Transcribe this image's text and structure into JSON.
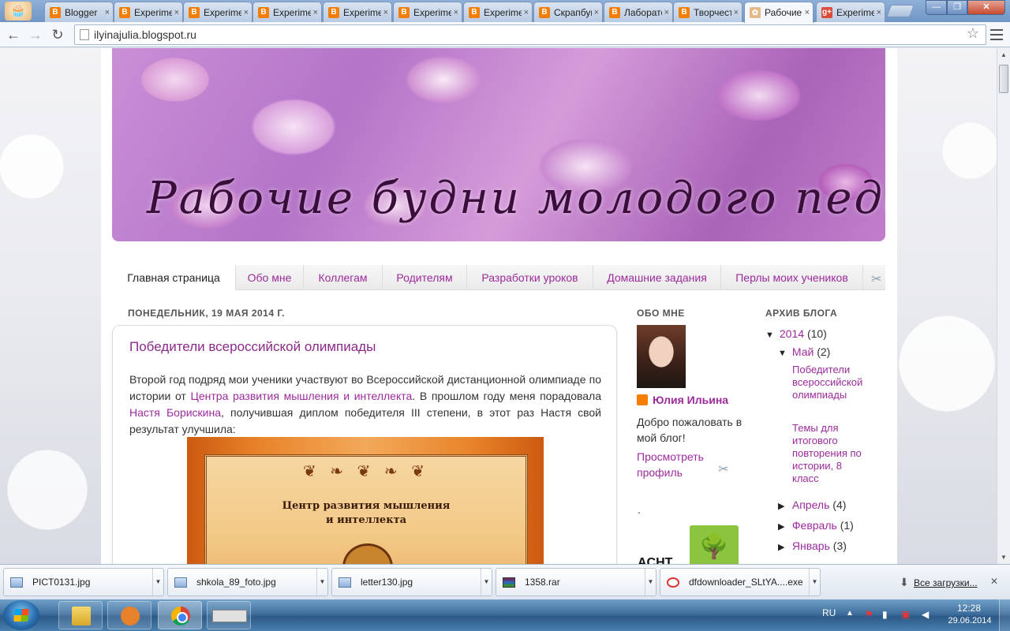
{
  "browser": {
    "tabs": [
      {
        "title": "Blogger",
        "icon": "blogger-icon"
      },
      {
        "title": "Experiment",
        "icon": "blogger-icon"
      },
      {
        "title": "Experiment",
        "icon": "blogger-icon"
      },
      {
        "title": "Experiment",
        "icon": "blogger-icon"
      },
      {
        "title": "Experiment",
        "icon": "blogger-icon"
      },
      {
        "title": "Experiment",
        "icon": "blogger-icon"
      },
      {
        "title": "Experiment",
        "icon": "blogger-icon"
      },
      {
        "title": "Скрапбукинг",
        "icon": "blogger-icon"
      },
      {
        "title": "Лаборатория",
        "icon": "blogger-icon"
      },
      {
        "title": "Творчество",
        "icon": "blogger-icon"
      },
      {
        "title": "Рабочие будни",
        "icon": "rose-icon",
        "active": true
      },
      {
        "title": "Experiment",
        "icon": "google-plus-icon"
      }
    ],
    "tab_close": "×",
    "url": "ilyinajulia.blogspot.ru",
    "bookmark_star": "☆"
  },
  "blog": {
    "title": "Рабочие будни молодого педагога",
    "nav": [
      "Главная страница",
      "Обо мне",
      "Коллегам",
      "Родителям",
      "Разработки уроков",
      "Домашние задания",
      "Перлы моих учеников"
    ],
    "date_header": "ПОНЕДЕЛЬНИК, 19 МАЯ 2014 Г.",
    "post": {
      "title": "Победители всероссийской олимпиады",
      "p1": "Второй год подряд мои ученики участвуют во Всероссийской дистанционной олимпиаде по истории от ",
      "link1": "Центра развития мышления и интеллекта",
      "p2": ". В прошлом году меня порадовала ",
      "link2": "Настя Борискина",
      "p3": ", получившая диплом победителя III степени, в этот раз Настя свой результат улучшила:",
      "certificate_text_line1": "Центр развития мышления",
      "certificate_text_line2": "и интеллекта"
    },
    "sidebar": {
      "about_header": "ОБО МНЕ",
      "profile_name": "Юлия Ильина",
      "profile_desc": "Добро пожаловать в мой блог!",
      "profile_link": "Просмотреть профиль",
      "dot": ".",
      "partial_logo_text": "ACHT",
      "archive_header": "АРХИВ БЛОГА",
      "archive": {
        "year": "2014",
        "year_count": "(10)",
        "may": "Май",
        "may_count": "(2)",
        "may_posts": [
          "Победители всероссийской олимпиады",
          "Темы для итогового повторения по истории, 8 класс"
        ],
        "april": "Апрель",
        "april_count": "(4)",
        "february": "Февраль",
        "february_count": "(1)",
        "january": "Январь",
        "january_count": "(3)"
      }
    }
  },
  "downloads": {
    "items": [
      {
        "name": "PICT0131.jpg",
        "type": "image-file-icon"
      },
      {
        "name": "shkola_89_foto.jpg",
        "type": "image-file-icon"
      },
      {
        "name": "letter130.jpg",
        "type": "image-file-icon"
      },
      {
        "name": "1358.rar",
        "type": "archive-file-icon"
      },
      {
        "name": "dfdownloader_SLtYA....exe",
        "type": "exe-file-icon"
      }
    ],
    "show_all": "Все загрузки..."
  },
  "taskbar": {
    "language": "RU",
    "time": "12:28",
    "date": "29.06.2014"
  },
  "colors": {
    "link": "#9c2b9c",
    "blogger": "#f57d00"
  }
}
